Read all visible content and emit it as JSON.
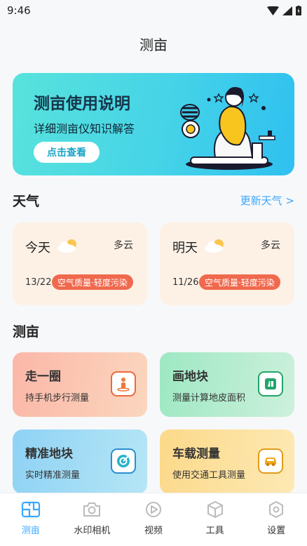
{
  "status": {
    "time": "9:46"
  },
  "page_title": "测亩",
  "banner": {
    "title": "测亩使用说明",
    "subtitle": "详细测亩仪知识解答",
    "button": "点击查看"
  },
  "weather": {
    "heading": "天气",
    "refresh": "更新天气 >",
    "cards": [
      {
        "day": "今天",
        "condition": "多云",
        "date": "13/22",
        "aqi": "空气质量·轻度污染"
      },
      {
        "day": "明天",
        "condition": "多云",
        "date": "11/26",
        "aqi": "空气质量·轻度污染"
      }
    ]
  },
  "measure": {
    "heading": "测亩",
    "cards": [
      {
        "title": "走一圈",
        "subtitle": "持手机步行测量",
        "icon": "walking-person-icon"
      },
      {
        "title": "画地块",
        "subtitle": "测量计算地皮面积",
        "icon": "map-plot-icon"
      },
      {
        "title": "精准地块",
        "subtitle": "实时精准测量",
        "icon": "precision-target-icon"
      },
      {
        "title": "车载测量",
        "subtitle": "使用交通工具测量",
        "icon": "car-icon"
      }
    ]
  },
  "tabs": [
    {
      "label": "测亩",
      "icon": "map-measure-icon",
      "active": true
    },
    {
      "label": "水印相机",
      "icon": "camera-icon",
      "active": false
    },
    {
      "label": "视频",
      "icon": "play-icon",
      "active": false
    },
    {
      "label": "工具",
      "icon": "cube-icon",
      "active": false
    },
    {
      "label": "设置",
      "icon": "settings-icon",
      "active": false
    }
  ],
  "colors": {
    "accent": "#3aa7ff",
    "aqi_badge": "#f0694e"
  }
}
